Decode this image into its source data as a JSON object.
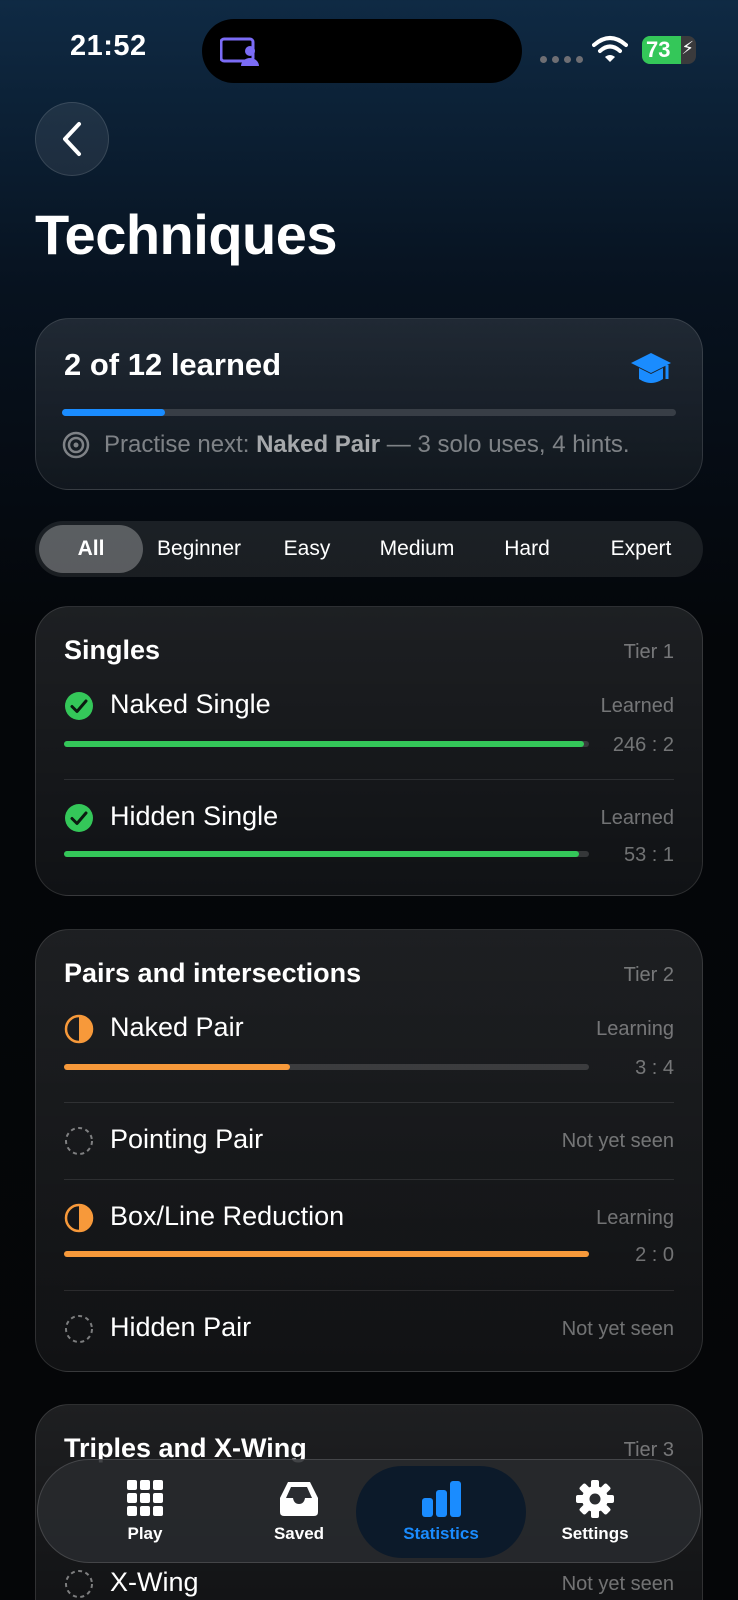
{
  "status_bar": {
    "time": "21:52",
    "battery": "73",
    "battery_level": 0.73
  },
  "page": {
    "title": "Techniques"
  },
  "summary": {
    "title": "2 of 12 learned",
    "progress": 0.167,
    "practise_prefix": "Practise next: ",
    "practise_technique": "Naked Pair",
    "practise_suffix": " — 3 solo uses, 4 hints."
  },
  "filters": [
    "All",
    "Beginner",
    "Easy",
    "Medium",
    "Hard",
    "Expert"
  ],
  "active_filter": "All",
  "tiers": [
    {
      "name": "Singles",
      "tier": "Tier 1",
      "techniques": [
        {
          "name": "Naked Single",
          "status": "Learned",
          "ratio": "246 : 2",
          "state": "learned",
          "progress": 0.99
        },
        {
          "name": "Hidden Single",
          "status": "Learned",
          "ratio": "53 : 1",
          "state": "learned",
          "progress": 0.98
        }
      ]
    },
    {
      "name": "Pairs and intersections",
      "tier": "Tier 2",
      "techniques": [
        {
          "name": "Naked Pair",
          "status": "Learning",
          "ratio": "3 : 4",
          "state": "learning",
          "progress": 0.43
        },
        {
          "name": "Pointing Pair",
          "status": "Not yet seen",
          "state": "unseen"
        },
        {
          "name": "Box/Line Reduction",
          "status": "Learning",
          "ratio": "2 : 0",
          "state": "learning",
          "progress": 1.0
        },
        {
          "name": "Hidden Pair",
          "status": "Not yet seen",
          "state": "unseen"
        }
      ]
    },
    {
      "name": "Triples and X-Wing",
      "tier": "Tier 3",
      "techniques": [
        {
          "name": "X-Wing",
          "status": "Not yet seen",
          "state": "unseen"
        }
      ]
    }
  ],
  "tabs": [
    {
      "label": "Play",
      "icon": "grid-icon"
    },
    {
      "label": "Saved",
      "icon": "tray-icon"
    },
    {
      "label": "Statistics",
      "icon": "bar-chart-icon",
      "active": true
    },
    {
      "label": "Settings",
      "icon": "gear-icon"
    }
  ],
  "colors": {
    "accent": "#1a8cff",
    "learned": "#34c759",
    "learning": "#f7993a"
  }
}
